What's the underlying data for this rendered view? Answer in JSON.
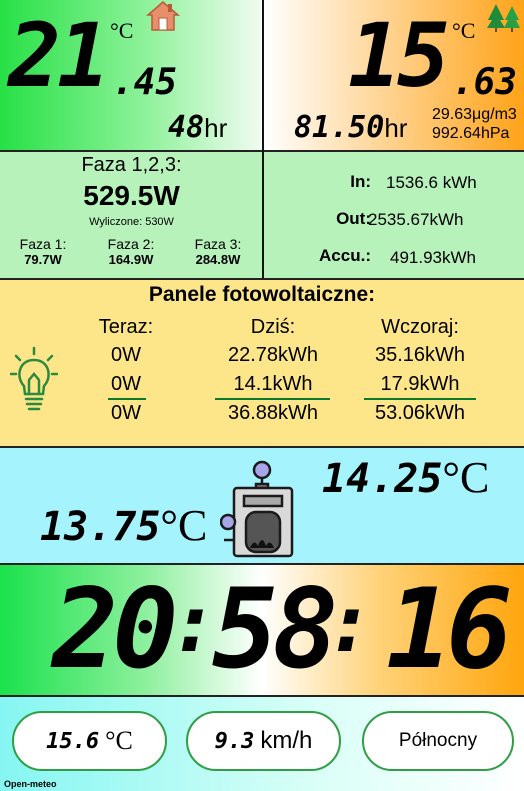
{
  "indoor": {
    "temp_int": "21",
    "temp_dec": ".45",
    "unit": "°C",
    "humidity": "48",
    "humidity_unit": "hr",
    "icon": "house-icon"
  },
  "outdoor": {
    "temp_int": "15",
    "temp_dec": ".63",
    "unit": "°C",
    "humidity": "81.50",
    "humidity_unit": "hr",
    "pm": "29.63μg/m3",
    "pressure": "992.64hPa",
    "icon": "forest-icon"
  },
  "phases": {
    "title": "Faza 1,2,3:",
    "total": "529.5W",
    "computed": "Wyliczone: 530W",
    "items": [
      {
        "label": "Faza 1:",
        "value": "79.7W"
      },
      {
        "label": "Faza 2:",
        "value": "164.9W"
      },
      {
        "label": "Faza 3:",
        "value": "284.8W"
      }
    ]
  },
  "energy": {
    "rows": [
      {
        "label": "In:",
        "value": "1536.6 kWh"
      },
      {
        "label": "Out:",
        "value": "2535.67kWh"
      },
      {
        "label": "Accu.:",
        "value": "491.93kWh"
      }
    ]
  },
  "pv": {
    "title": "Panele fotowoltaiczne:",
    "icon": "lightbulb-icon",
    "headers": [
      "Teraz:",
      "Dziś:",
      "Wczoraj:"
    ],
    "rows": [
      [
        "0W",
        "22.78kWh",
        "35.16kWh"
      ],
      [
        "0W",
        "14.1kWh",
        "17.9kWh"
      ],
      [
        "0W",
        "36.88kWh",
        "53.06kWh"
      ]
    ]
  },
  "boiler": {
    "temp_top": "14.25",
    "temp_bottom": "13.75",
    "unit": "°C",
    "icon": "boiler-icon"
  },
  "clock": {
    "hours": "20",
    "minutes": "58",
    "seconds": "16",
    "sep": ":"
  },
  "weather": {
    "temp": "15.6",
    "temp_unit": "°C",
    "wind": "9.3",
    "wind_unit": "km/h",
    "direction": "Północny",
    "source": "Open-meteo"
  }
}
